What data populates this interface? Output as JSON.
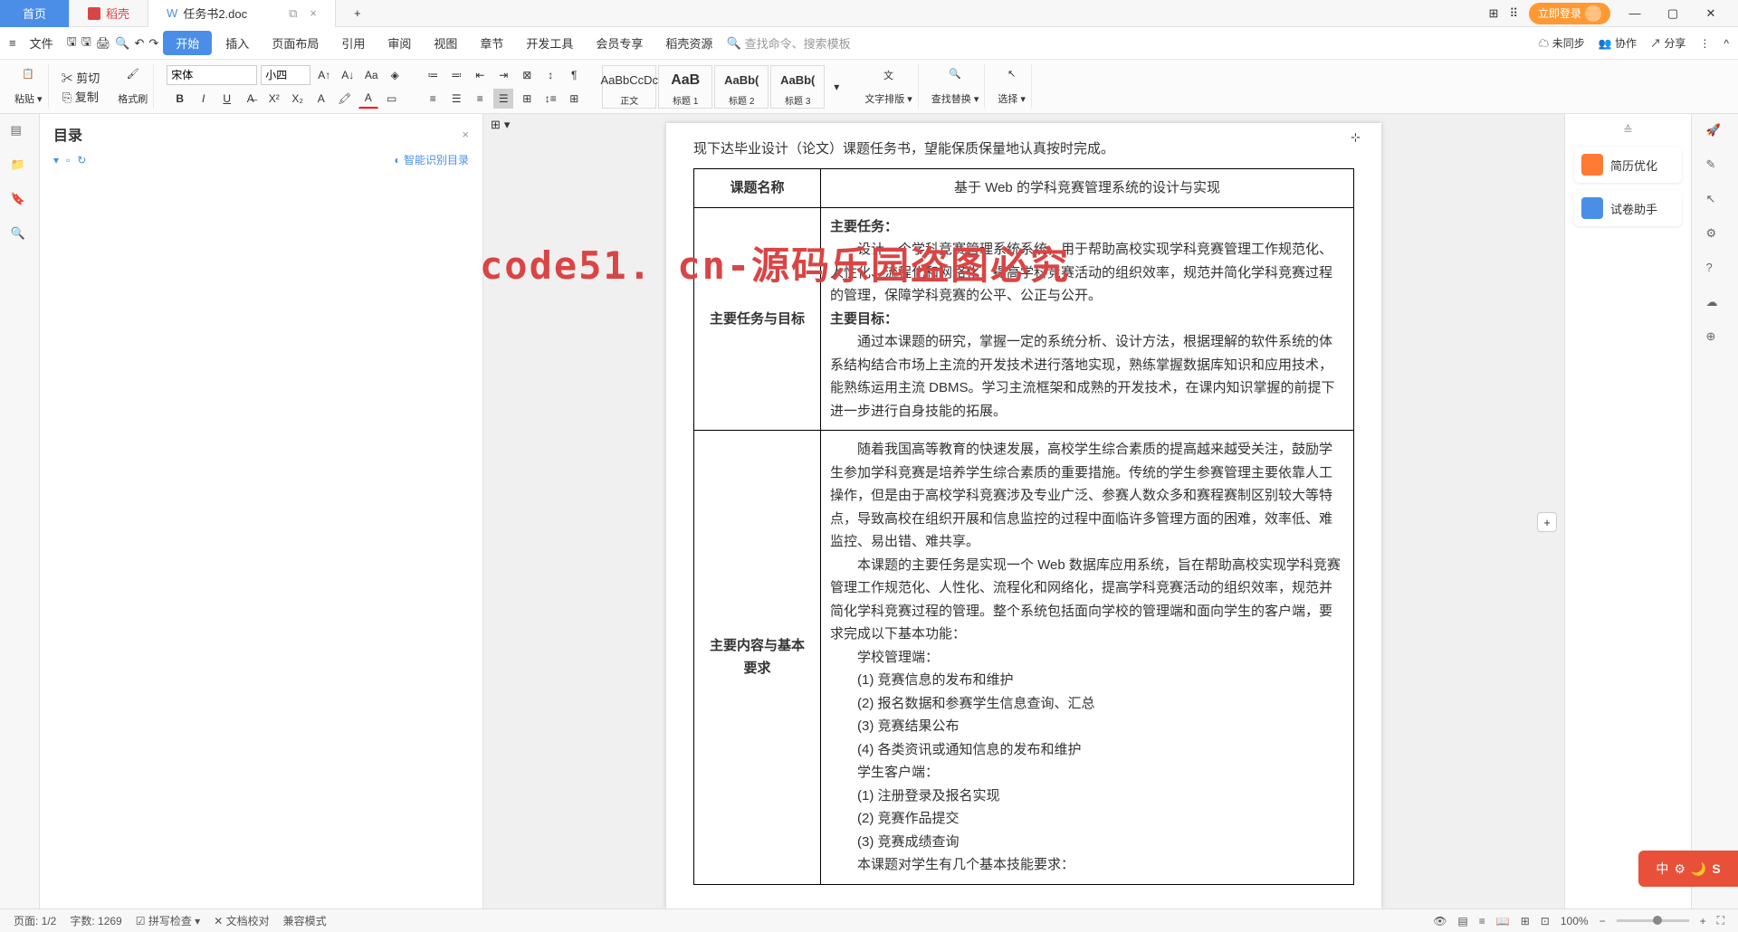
{
  "tabs": {
    "home": "首页",
    "dao": "稻壳",
    "doc": "任务书2.doc"
  },
  "titlebar": {
    "login": "立即登录"
  },
  "menu": {
    "file": "文件",
    "start": "开始",
    "insert": "插入",
    "layout": "页面布局",
    "ref": "引用",
    "review": "审阅",
    "view": "视图",
    "chapter": "章节",
    "dev": "开发工具",
    "member": "会员专享",
    "resource": "稻壳资源"
  },
  "menu_right": {
    "search": "查找命令、搜索模板",
    "unsync": "未同步",
    "collab": "协作",
    "share": "分享"
  },
  "ribbon": {
    "paste": "粘贴",
    "cut": "剪切",
    "copy": "复制",
    "format": "格式刷",
    "font": "宋体",
    "size": "小四",
    "styles": [
      {
        "prev": "AaBbCcDc",
        "name": "正文"
      },
      {
        "prev": "AaB",
        "name": "标题 1"
      },
      {
        "prev": "AaBb(",
        "name": "标题 2"
      },
      {
        "prev": "AaBb(",
        "name": "标题 3"
      }
    ],
    "typeset": "文字排版",
    "findrep": "查找替换",
    "select": "选择"
  },
  "outline": {
    "title": "目录",
    "smart": "智能识别目录"
  },
  "rightpanel": {
    "resume": "简历优化",
    "exam": "试卷助手"
  },
  "doc": {
    "head_line": "现下达毕业设计（论文）课题任务书，望能保质保量地认真按时完成。",
    "r1_label": "课题名称",
    "r1_val": "基于 Web 的学科竞赛管理系统的设计与实现",
    "r2_label": "主要任务与目标",
    "task_h": "主要任务：",
    "task_p": "设计一个学科竞赛管理系统系统，用于帮助高校实现学科竞赛管理工作规范化、人性化、流程化和网络化，提高学科竞赛活动的组织效率，规范并简化学科竞赛过程的管理，保障学科竞赛的公平、公正与公开。",
    "goal_h": "主要目标：",
    "goal_p": "通过本课题的研究，掌握一定的系统分析、设计方法，根据理解的软件系统的体系结构结合市场上主流的开发技术进行落地实现，熟练掌握数据库知识和应用技术，能熟练运用主流 DBMS。学习主流框架和成熟的开发技术，在课内知识掌握的前提下进一步进行自身技能的拓展。",
    "r3_label": "主要内容与基本要求",
    "c1": "随着我国高等教育的快速发展，高校学生综合素质的提高越来越受关注，鼓励学生参加学科竞赛是培养学生综合素质的重要措施。传统的学生参赛管理主要依靠人工操作，但是由于高校学科竞赛涉及专业广泛、参赛人数众多和赛程赛制区别较大等特点，导致高校在组织开展和信息监控的过程中面临许多管理方面的困难，效率低、难监控、易出错、难共享。",
    "c2": "本课题的主要任务是实现一个 Web 数据库应用系统，旨在帮助高校实现学科竞赛管理工作规范化、人性化、流程化和网络化，提高学科竞赛活动的组织效率，规范并简化学科竞赛过程的管理。整个系统包括面向学校的管理端和面向学生的客户端，要求完成以下基本功能：",
    "sch_h": "学校管理端：",
    "s1": "(1) 竞赛信息的发布和维护",
    "s2": "(2) 报名数据和参赛学生信息查询、汇总",
    "s3": "(3) 竞赛结果公布",
    "s4": "(4) 各类资讯或通知信息的发布和维护",
    "stu_h": "学生客户端：",
    "t1": "(1) 注册登录及报名实现",
    "t2": "(2) 竞赛作品提交",
    "t3": "(3) 竞赛成绩查询",
    "req": "本课题对学生有几个基本技能要求："
  },
  "status": {
    "page": "页面: 1/2",
    "words": "字数: 1269",
    "spell": "拼写检查",
    "proof": "文档校对",
    "compat": "兼容模式",
    "zoom": "100%"
  },
  "watermark": "code51. cn-源码乐园盗图必究",
  "ime": "中"
}
